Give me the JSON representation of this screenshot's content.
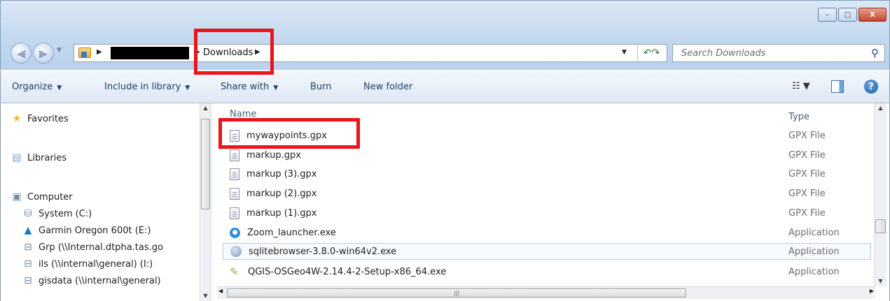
{
  "window": {
    "caption_buttons": {
      "minimize": "–",
      "maximize": "□",
      "close": "X"
    }
  },
  "address": {
    "current_folder": "Downloads",
    "refresh_glyph": "↶↷"
  },
  "search": {
    "placeholder": "Search Downloads"
  },
  "toolbar": {
    "organize": "Organize",
    "include_in_library": "Include in library",
    "share_with": "Share with",
    "burn": "Burn",
    "new_folder": "New folder"
  },
  "navpane": {
    "favorites": "Favorites",
    "libraries": "Libraries",
    "computer": "Computer",
    "drives": [
      "System (C:)",
      "Garmin Oregon 600t (E:)",
      "Grp (\\\\Internal.dtpha.tas.go",
      "ils (\\\\internal\\general) (I:)",
      "gisdata (\\\\internal\\general)"
    ]
  },
  "filelist": {
    "columns": {
      "name": "Name",
      "type": "Type"
    },
    "files": [
      {
        "name": "mywaypoints.gpx",
        "type": "GPX File",
        "icon": "document-icon"
      },
      {
        "name": "markup.gpx",
        "type": "GPX File",
        "icon": "document-icon"
      },
      {
        "name": "markup (3).gpx",
        "type": "GPX File",
        "icon": "document-icon"
      },
      {
        "name": "markup (2).gpx",
        "type": "GPX File",
        "icon": "document-icon"
      },
      {
        "name": "markup (1).gpx",
        "type": "GPX File",
        "icon": "document-icon"
      },
      {
        "name": "Zoom_launcher.exe",
        "type": "Application",
        "icon": "zoom-app-icon"
      },
      {
        "name": "sqlitebrowser-3.8.0-win64v2.exe",
        "type": "Application",
        "icon": "sqlite-app-icon"
      },
      {
        "name": "QGIS-OSGeo4W-2.14.4-2-Setup-x86_64.exe",
        "type": "Application",
        "icon": "qgis-app-icon"
      }
    ]
  },
  "annotations": {
    "highlight_color": "#e8161b"
  }
}
